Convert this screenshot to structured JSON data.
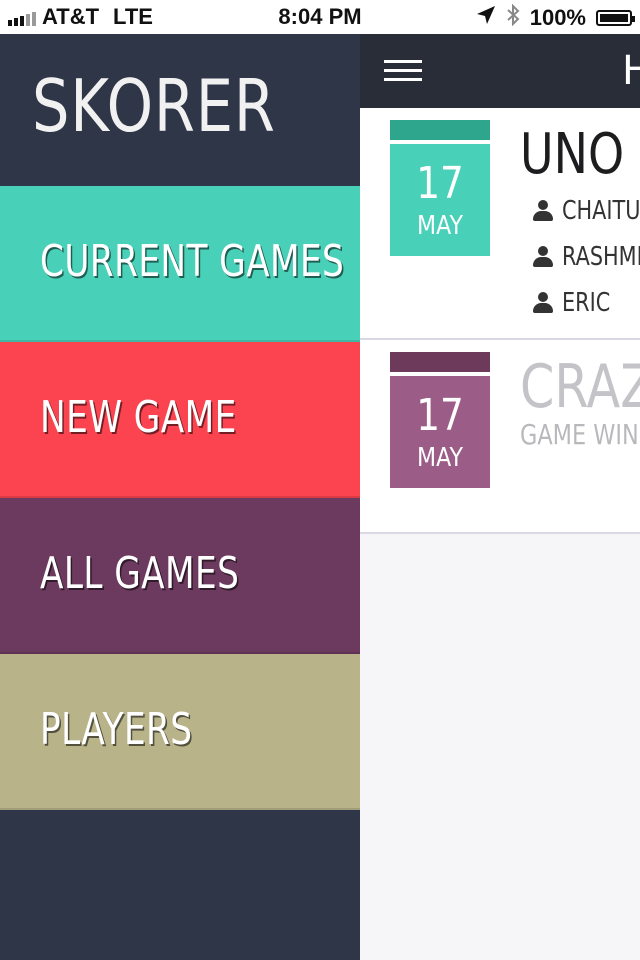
{
  "status_bar": {
    "carrier": "AT&T",
    "network": "LTE",
    "time": "8:04 PM",
    "battery_percent": "100%",
    "battery_level": 1.0,
    "icons": [
      "signal-bars-icon",
      "location-arrow-icon",
      "bluetooth-icon",
      "battery-icon"
    ]
  },
  "sidebar": {
    "brand": "SKORER",
    "items": [
      {
        "label": "CURRENT GAMES",
        "color": "#48d1b8"
      },
      {
        "label": "NEW GAME",
        "color": "#fb4450"
      },
      {
        "label": "ALL GAMES",
        "color": "#6d3a5f"
      },
      {
        "label": "PLAYERS",
        "color": "#b9b38a"
      }
    ]
  },
  "main": {
    "header_title": "H",
    "games": [
      {
        "day": "17",
        "month": "MAY",
        "title": "UNO @",
        "accent_band": "#2ea58d",
        "accent": "#48d1b8",
        "players": [
          "CHAITU",
          "RASHMI",
          "ERIC"
        ]
      },
      {
        "day": "17",
        "month": "MAY",
        "title": "CRAZY",
        "subtitle": "GAME WINN",
        "accent_band": "#6e3a5c",
        "accent": "#9b5d87"
      }
    ]
  }
}
